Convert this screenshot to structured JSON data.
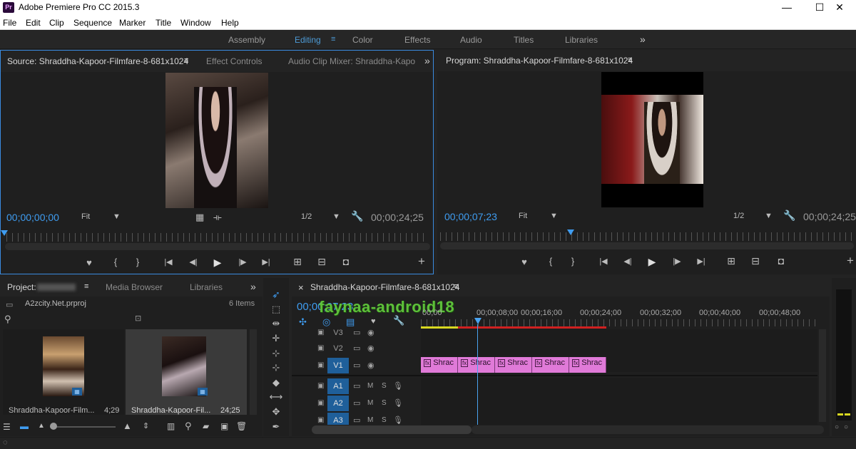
{
  "app": {
    "logo": "Pr",
    "title": "Adobe Premiere Pro CC 2015.3",
    "window_controls": [
      "—",
      "☐",
      "✕"
    ]
  },
  "menu": [
    "File",
    "Edit",
    "Clip",
    "Sequence",
    "Marker",
    "Title",
    "Window",
    "Help"
  ],
  "workspaces": {
    "items": [
      "Assembly",
      "Editing",
      "Color",
      "Effects",
      "Audio",
      "Titles",
      "Libraries"
    ],
    "active": "Editing",
    "menu_glyph": "≡",
    "overflow": "»"
  },
  "source_panel": {
    "tabs": [
      "Source: Shraddha-Kapoor-Filmfare-8-681x1024",
      "Effect Controls",
      "Audio Clip Mixer: Shraddha-Kapo"
    ],
    "tab_menu": "≡",
    "overflow": "»",
    "timecode_in": "00;00;00;00",
    "fit": "Fit",
    "resolution": "1/2",
    "duration": "00;00;24;25"
  },
  "program_panel": {
    "tab": "Program: Shraddha-Kapoor-Filmfare-8-681x1024",
    "tab_menu": "≡",
    "timecode": "00;00;07;23",
    "fit": "Fit",
    "resolution": "1/2",
    "duration": "00;00;24;25"
  },
  "project_panel": {
    "tabs": [
      "Project:",
      "Media Browser",
      "Libraries"
    ],
    "tab_menu": "≡",
    "overflow": "»",
    "project_file": "A2zcity.Net.prproj",
    "items_count": "6 Items",
    "items": [
      {
        "name": "Shraddha-Kapoor-Film...",
        "duration": "4;29"
      },
      {
        "name": "Shraddha-Kapoor-Fil...",
        "duration": "24;25"
      }
    ]
  },
  "timeline": {
    "tab": "Shraddha-Kapoor-Filmfare-8-681x1024",
    "tab_menu": "≡",
    "close_glyph": "×",
    "timecode": "00;00;07;23",
    "ruler": [
      "00;00",
      "00;00;08;00",
      "00;00;16;00",
      "00;00;24;00",
      "00;00;32;00",
      "00;00;40;00",
      "00;00;48;00"
    ],
    "video_tracks": [
      "V3",
      "V2",
      "V1"
    ],
    "audio_tracks": [
      "A1",
      "A2",
      "A3"
    ],
    "track_toggles": {
      "mute": "M",
      "solo": "S"
    },
    "clip_fx": "fx",
    "clip_label": "Shrac",
    "clip_count": 5
  },
  "watermark": "faynaa-android18",
  "colors": {
    "accent": "#3f9cf0",
    "clip": "#e07ad8",
    "track_on": "#1f5f9a",
    "playhead": "#4aa3f0",
    "render_bar": "#d02020",
    "render_ok": "#d8d820"
  },
  "icons": {
    "marker": "♥",
    "in": "{",
    "out": "}",
    "go_in": "|◀",
    "step_back": "◀|",
    "play": "▶",
    "step_fwd": "|▶",
    "go_out": "▶|",
    "insert": "⊞",
    "overwrite": "⊟",
    "camera": "◘",
    "add": "+",
    "wrench": "🔧",
    "lock": "🔒",
    "eye": "◉",
    "mic": "🎙",
    "folder": "📁",
    "search": "⚲"
  }
}
